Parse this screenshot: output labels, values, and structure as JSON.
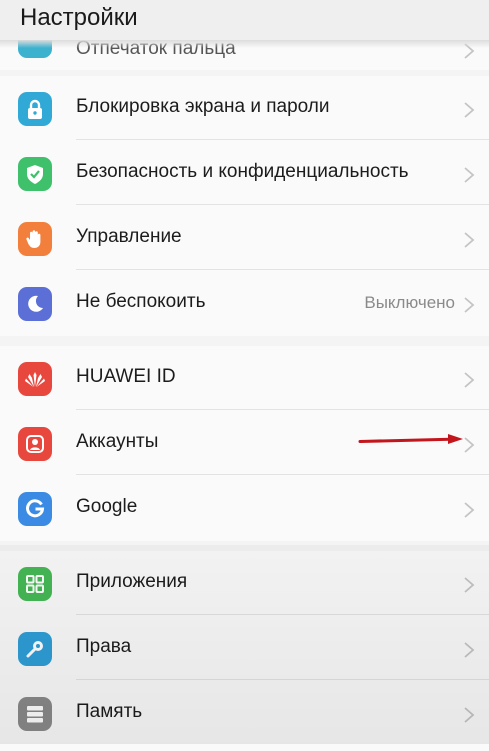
{
  "header": {
    "title": "Настройки"
  },
  "partial_item": {
    "label": "Отпечаток пальца",
    "color": "#3db2cf"
  },
  "section1": [
    {
      "label": "Блокировка экрана и пароли",
      "icon": "lock-icon",
      "color": "#31a9d6"
    },
    {
      "label": "Безопасность и конфиденциальность",
      "icon": "shield-check-icon",
      "color": "#3fc06b"
    },
    {
      "label": "Управление",
      "icon": "hand-icon",
      "color": "#f37f3d"
    },
    {
      "label": "Не беспокоить",
      "icon": "moon-icon",
      "color": "#5b6fd6",
      "value": "Выключено"
    }
  ],
  "section2": [
    {
      "label": "HUAWEI ID",
      "icon": "huawei-logo-icon",
      "color": "#e8473e"
    },
    {
      "label": "Аккаунты",
      "icon": "account-icon",
      "color": "#e8473e"
    },
    {
      "label": "Google",
      "icon": "google-icon",
      "color": "#3b8be4"
    }
  ],
  "section3": [
    {
      "label": "Приложения",
      "icon": "apps-grid-icon",
      "color": "#45b955"
    },
    {
      "label": "Права",
      "icon": "key-icon",
      "color": "#2f9fd8"
    },
    {
      "label": "Память",
      "icon": "storage-icon",
      "color": "#8a8a8a"
    }
  ],
  "annotation_arrow_color": "#c2161c"
}
